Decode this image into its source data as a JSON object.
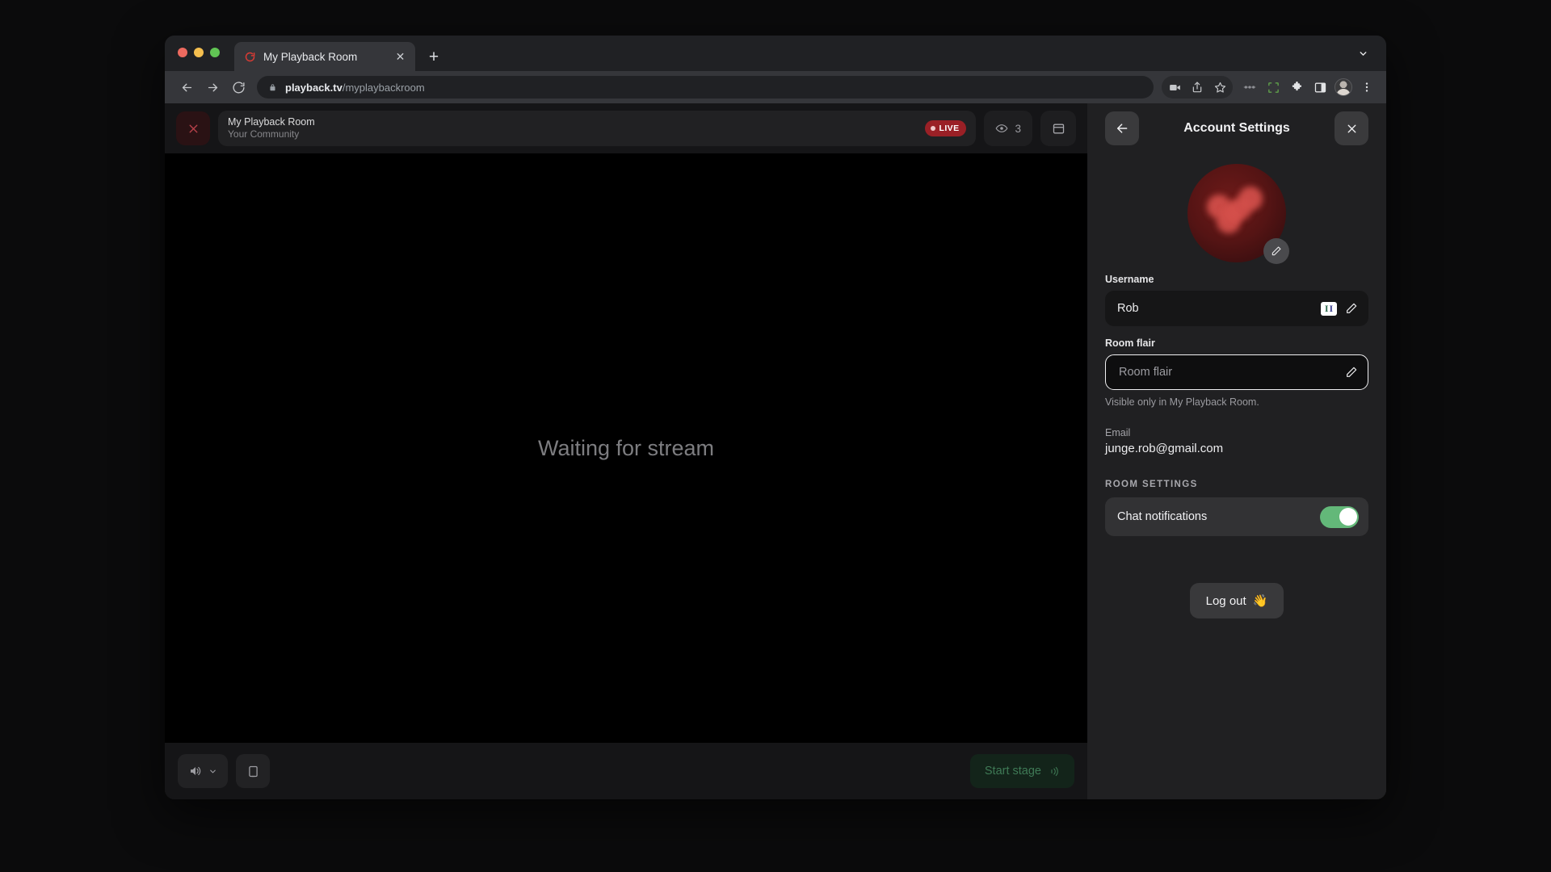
{
  "browser": {
    "tab": {
      "title": "My Playback Room",
      "favicon": "replay-loop-icon",
      "close_label": "✕"
    },
    "new_tab_label": "+",
    "toolbar": {
      "back_icon": "back-arrow-icon",
      "forward_icon": "forward-arrow-icon",
      "reload_icon": "reload-icon",
      "lock_icon": "lock-icon",
      "url_host": "playback.tv",
      "url_path": "/myplaybackroom",
      "icons": [
        "video-camera-icon",
        "share-icon",
        "bookmark-star-icon",
        "extension-media-icon",
        "screen-capture-icon",
        "puzzle-extensions-icon",
        "side-panel-icon",
        "profile-avatar-icon",
        "kebab-menu-icon"
      ]
    }
  },
  "stage": {
    "close_label": "✕",
    "room_name": "My Playback Room",
    "room_subtitle": "Your Community",
    "live_label": "LIVE",
    "viewer_count": "3",
    "viewer_icon": "eye-icon",
    "layout_icon": "layout-window-icon",
    "video_placeholder": "Waiting for stream",
    "volume_icon": "speaker-icon",
    "volume_chevron": "chevron-down-icon",
    "cast_icon": "screen-share-icon",
    "start_stage_label": "Start stage",
    "start_stage_icon": "🔊"
  },
  "sidebar": {
    "back_label": "←",
    "title": "Account Settings",
    "close_label": "✕",
    "avatar_edit_icon": "pencil-icon",
    "username": {
      "label": "Username",
      "value": "Rob",
      "badge_left": "I",
      "badge_right": "I",
      "edit_icon": "pencil-icon"
    },
    "room_flair": {
      "label": "Room flair",
      "value": "",
      "placeholder": "Room flair",
      "edit_icon": "pencil-icon",
      "helper": "Visible only in My Playback Room."
    },
    "email": {
      "label": "Email",
      "value": "junge.rob@gmail.com"
    },
    "section_room_settings": "ROOM SETTINGS",
    "chat_notifications": {
      "label": "Chat notifications",
      "enabled": true
    },
    "logout": {
      "label": "Log out",
      "icon": "👋"
    }
  },
  "colors": {
    "accent_red": "#b8414a",
    "live_red": "#9a2026",
    "toggle_green": "#63b879",
    "start_stage_green": "#3f7a56",
    "panel_bg": "#202022",
    "browser_chrome": "#35363a"
  }
}
